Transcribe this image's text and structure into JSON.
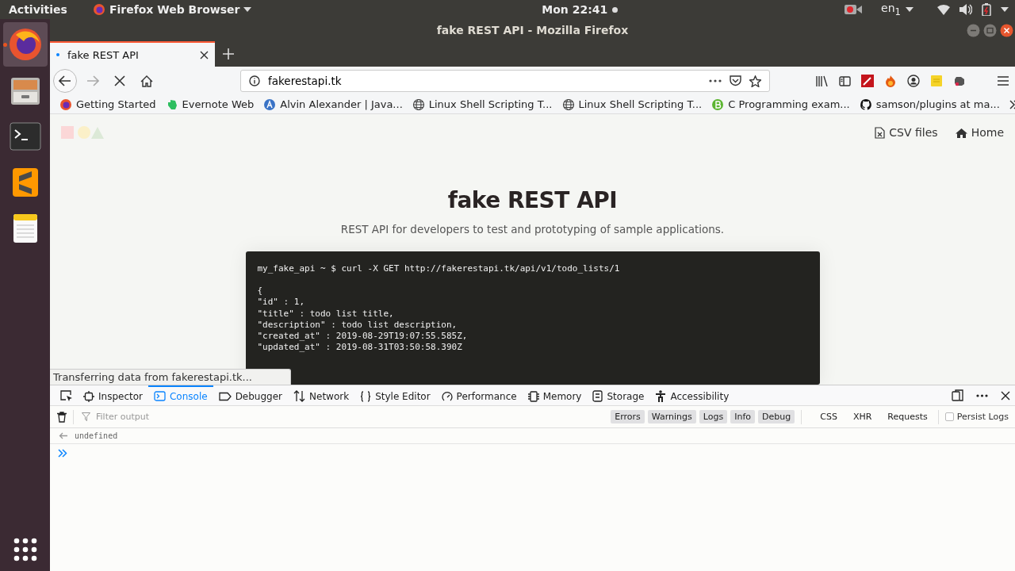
{
  "top_bar": {
    "activities": "Activities",
    "app_menu": "Firefox Web Browser",
    "clock": "Mon 22:41",
    "keyboard_layout": "en$_{1}$"
  },
  "dock": [
    {
      "kind": "firefox",
      "selected": true
    },
    {
      "kind": "files",
      "selected": false
    },
    {
      "kind": "terminal",
      "selected": false
    },
    {
      "kind": "sublime",
      "selected": false
    },
    {
      "kind": "notes",
      "selected": false
    }
  ],
  "window": {
    "title": "fake REST API - Mozilla Firefox"
  },
  "tabs": [
    {
      "label": "fake REST API",
      "selected": true
    }
  ],
  "address_bar": {
    "url": "fakerestapi.tk"
  },
  "bookmarks": [
    {
      "label": "Getting Started",
      "kind": "firefox"
    },
    {
      "label": "Evernote Web",
      "kind": "evernote"
    },
    {
      "label": "Alvin Alexander | Java...",
      "kind": "letter-a"
    },
    {
      "label": "Linux Shell Scripting T...",
      "kind": "globe"
    },
    {
      "label": "Linux Shell Scripting T...",
      "kind": "globe"
    },
    {
      "label": "C Programming exam...",
      "kind": "letter-b"
    },
    {
      "label": "samson/plugins at ma...",
      "kind": "github"
    }
  ],
  "page": {
    "nav": [
      {
        "label": "CSV files",
        "kind": "file"
      },
      {
        "label": "Home",
        "kind": "home"
      }
    ],
    "title": "fake REST API",
    "subtitle": "REST API for developers to test and prototyping of sample applications.",
    "terminal": {
      "command": "my_fake_api ~ $ curl -X GET http://fakerestapi.tk/api/v1/todo_lists/1",
      "lines": [
        "{",
        "\"id\" : 1,",
        "\"title\" : todo list title,",
        "\"description\" : todo list description,",
        "\"created_at\" : 2019-08-29T19:07:55.585Z,",
        "\"updated_at\" : 2019-08-31T03:50:58.390Z"
      ]
    }
  },
  "status": "Transferring data from fakerestapi.tk...",
  "devtools": {
    "tabs": [
      {
        "label": "Inspector",
        "kind": "inspector",
        "selected": false
      },
      {
        "label": "Console",
        "kind": "console",
        "selected": true
      },
      {
        "label": "Debugger",
        "kind": "debugger",
        "selected": false
      },
      {
        "label": "Network",
        "kind": "network",
        "selected": false
      },
      {
        "label": "Style Editor",
        "kind": "style",
        "selected": false
      },
      {
        "label": "Performance",
        "kind": "performance",
        "selected": false
      },
      {
        "label": "Memory",
        "kind": "memory",
        "selected": false
      },
      {
        "label": "Storage",
        "kind": "storage",
        "selected": false
      },
      {
        "label": "Accessibility",
        "kind": "accessibility",
        "selected": false
      }
    ],
    "filter": {
      "placeholder": "Filter output"
    },
    "levels": [
      {
        "label": "Errors",
        "selected": true
      },
      {
        "label": "Warnings",
        "selected": true
      },
      {
        "label": "Logs",
        "selected": true
      },
      {
        "label": "Info",
        "selected": true
      },
      {
        "label": "Debug",
        "selected": true
      }
    ],
    "types": [
      {
        "label": "CSS",
        "selected": false
      },
      {
        "label": "XHR",
        "selected": false
      },
      {
        "label": "Requests",
        "selected": false
      }
    ],
    "persist_logs": {
      "label": "Persist Logs",
      "checked": false
    },
    "messages": [
      {
        "kind": "result",
        "text": "undefined"
      }
    ]
  }
}
